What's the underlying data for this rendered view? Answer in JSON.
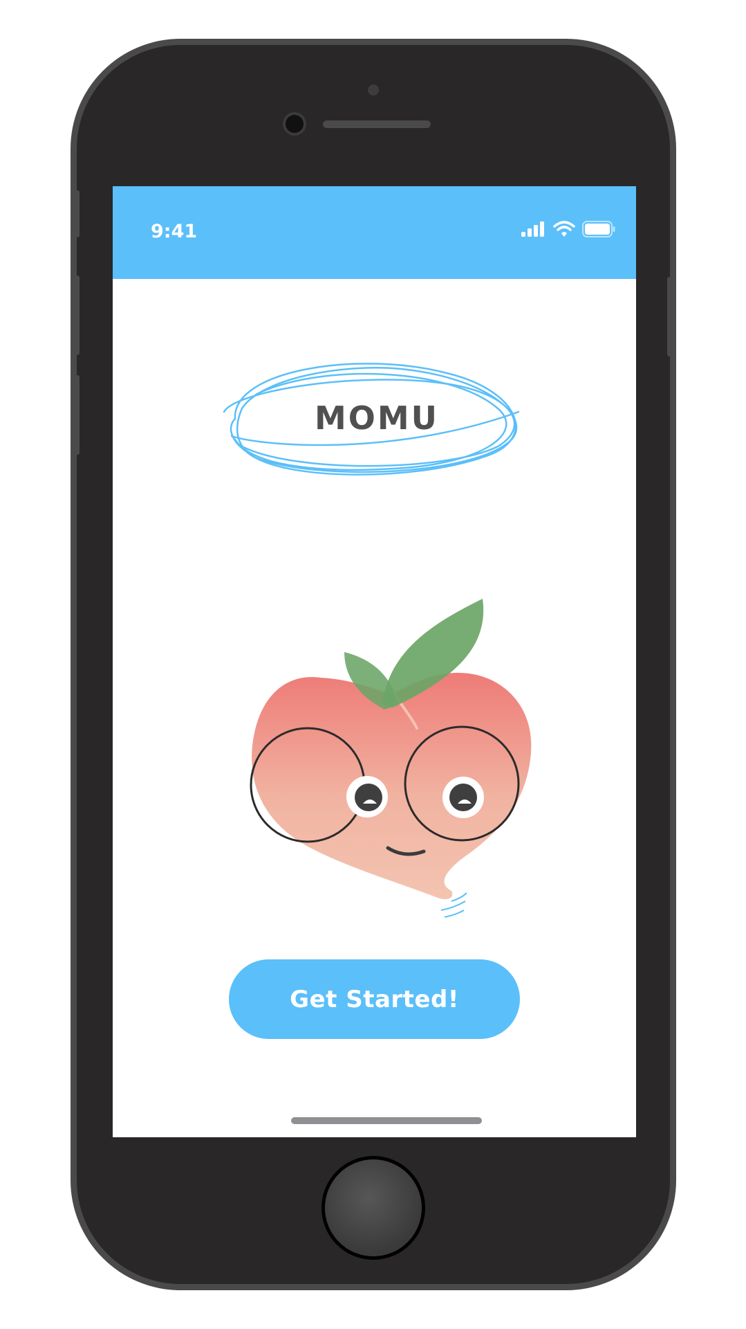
{
  "status_bar": {
    "time": "9:41",
    "background_color": "#5bbff9",
    "icons": [
      "cellular-signal-icon",
      "wifi-icon",
      "battery-icon"
    ]
  },
  "brand": {
    "title": "MOMU",
    "scribble_color": "#5bbff9"
  },
  "mascot": {
    "name": "peach-mascot-illustration"
  },
  "cta": {
    "label": "Get Started!",
    "color": "#5bbff9"
  },
  "colors": {
    "accent": "#5bbff9",
    "device_body": "#292728",
    "leaf": "#6ba566",
    "peach_top": "#ee7b77",
    "peach_bottom": "#f3c4b1"
  }
}
